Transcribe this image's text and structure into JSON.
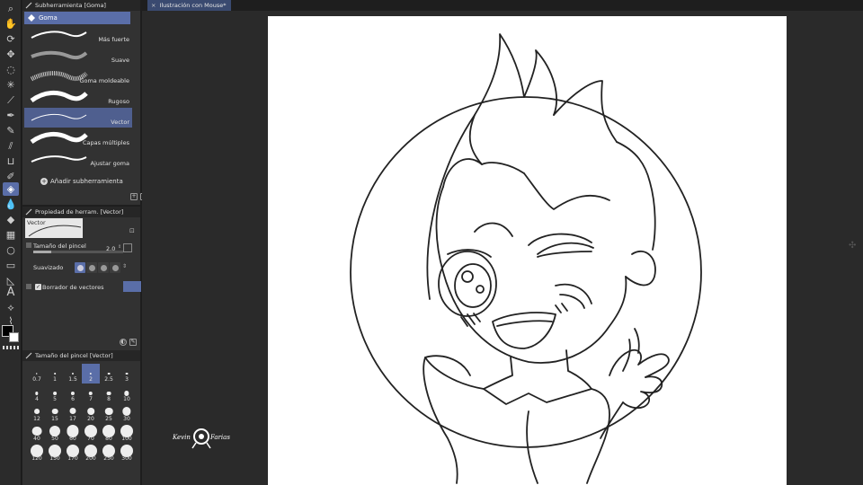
{
  "document": {
    "tab_title": "Ilustración con Mouse*"
  },
  "subtool_panel": {
    "title": "Subherramienta [Goma]",
    "group": "Goma",
    "items": [
      {
        "label": "Más fuerte"
      },
      {
        "label": "Suave"
      },
      {
        "label": "Goma moldeable"
      },
      {
        "label": "Rugoso"
      },
      {
        "label": "Vector"
      },
      {
        "label": "Capas múltiples"
      },
      {
        "label": "Ajustar goma"
      }
    ],
    "selected": "Vector",
    "add_label": "Añadir subherramienta"
  },
  "property_panel": {
    "title": "Propiedad de herram. [Vector]",
    "preview_label": "Vector",
    "brush_size_label": "Tamaño del pincel",
    "brush_size_value": "2.0",
    "brush_size_fraction": 0.2,
    "smoothing_label": "Suavizado",
    "vector_eraser_label": "Borrador de vectores",
    "vector_eraser_checked": true
  },
  "brush_size_panel": {
    "title": "Tamaño del pincel [Vector]",
    "sizes": [
      "0.7",
      "1",
      "1.5",
      "2",
      "2.5",
      "3",
      "4",
      "5",
      "6",
      "7",
      "8",
      "10",
      "12",
      "15",
      "17",
      "20",
      "25",
      "30",
      "40",
      "50",
      "60",
      "70",
      "80",
      "100",
      "120",
      "150",
      "170",
      "200",
      "250",
      "300"
    ],
    "selected": "2"
  },
  "watermark": {
    "text": "Kevin Farias"
  },
  "colors": {
    "accent": "#5a6ea8",
    "panel": "#323232",
    "canvas": "#ffffff"
  },
  "icons": [
    "zoom-icon",
    "hand-icon",
    "rotate-icon",
    "move-icon",
    "lasso-icon",
    "magic-wand-icon",
    "eyedropper-icon",
    "pen-icon",
    "pencil-icon",
    "brush-icon",
    "airbrush-icon",
    "decoration-icon",
    "eraser-icon",
    "blend-icon",
    "fill-icon",
    "gradient-icon",
    "figure-icon",
    "frame-icon",
    "ruler-icon",
    "text-icon",
    "balloon-icon",
    "correction-icon"
  ]
}
